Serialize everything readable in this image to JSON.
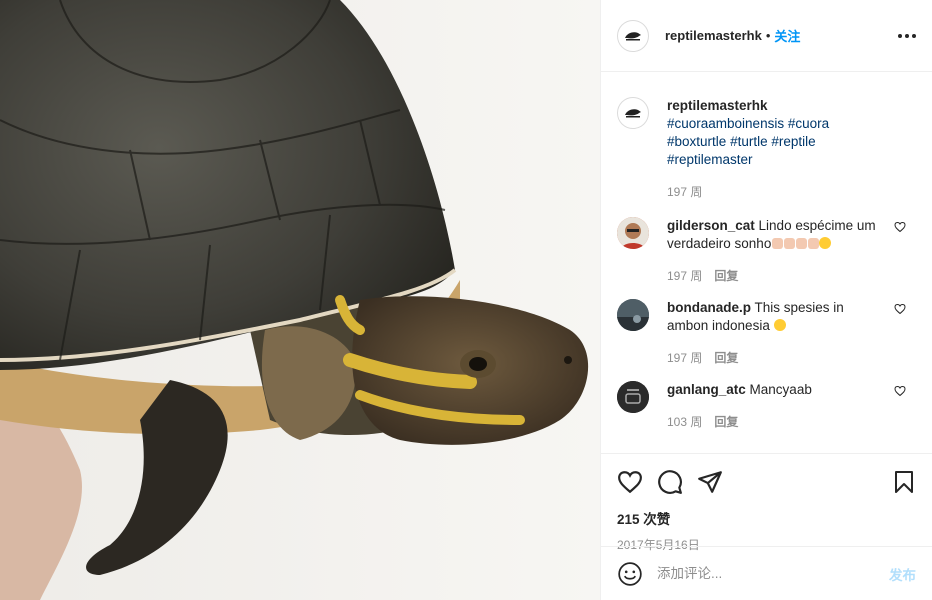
{
  "post": {
    "username": "reptilemasterhk",
    "follow_label": "关注",
    "separator": "•"
  },
  "caption": {
    "username": "reptilemasterhk",
    "hashtags": [
      "#cuoraamboinensis",
      "#cuora",
      "#boxturtle",
      "#turtle",
      "#reptile",
      "#reptilemaster"
    ],
    "time": "197 周"
  },
  "comments": [
    {
      "username": "gilderson_cat",
      "text": "Lindo espécime um verdadeiro sonho",
      "time": "197 周",
      "reply_label": "回复",
      "avatar_color": "#c0532f"
    },
    {
      "username": "bondanade.p",
      "text": "This spesies in ambon indonesia",
      "time": "197 周",
      "reply_label": "回复",
      "avatar_color": "#3d4a52"
    },
    {
      "username": "ganlang_atc",
      "text": "Mancyaab",
      "time": "103 周",
      "reply_label": "回复",
      "avatar_color": "#2b2b2b"
    }
  ],
  "likes": "215 次赞",
  "date": "2017年5月16日",
  "add_comment": {
    "placeholder": "添加评论...",
    "post_label": "发布"
  },
  "icons": {
    "like": "heart-icon",
    "comment": "comment-icon",
    "share": "share-icon",
    "save": "bookmark-icon",
    "more": "more-icon",
    "emoji": "emoji-icon"
  }
}
